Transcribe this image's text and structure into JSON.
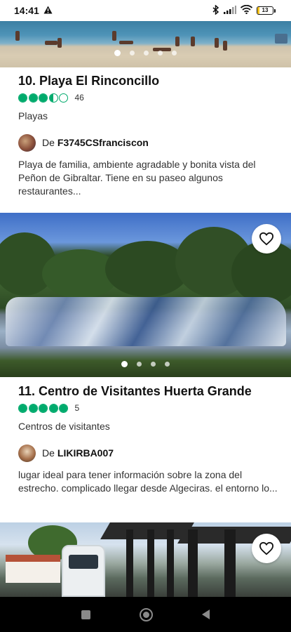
{
  "status_bar": {
    "time": "14:41",
    "battery": "13",
    "battery_level": 0.13,
    "icons": [
      "alert-icon",
      "bluetooth-icon",
      "signal-icon",
      "wifi-icon",
      "battery-icon"
    ]
  },
  "listings": [
    {
      "title": "10. Playa El Rinconcillo",
      "rating": 3.5,
      "review_count": "46",
      "category": "Playas",
      "author_prefix": "De",
      "author": "F3745CSfranciscon",
      "review": "Playa de familia, ambiente agradable y bonita vista del Peñon de Gibraltar. Tiene en su paseo algunos restaurantes...",
      "photo_count": 5,
      "active_photo": 0
    },
    {
      "title": "11. Centro de Visitantes Huerta Grande",
      "rating": 5,
      "review_count": "5",
      "category": "Centros de visitantes",
      "author_prefix": "De",
      "author": "LIKIRBA007",
      "review": "lugar ideal para tener información sobre la zona del estrecho. complicado llegar desde Algeciras. el entorno lo...",
      "photo_count": 4,
      "active_photo": 0
    }
  ],
  "colors": {
    "rating_green": "#00aa6c",
    "nav_bar": "#000000"
  },
  "nav": {
    "icons": [
      "recents-square-icon",
      "home-circle-icon",
      "back-triangle-icon"
    ]
  }
}
